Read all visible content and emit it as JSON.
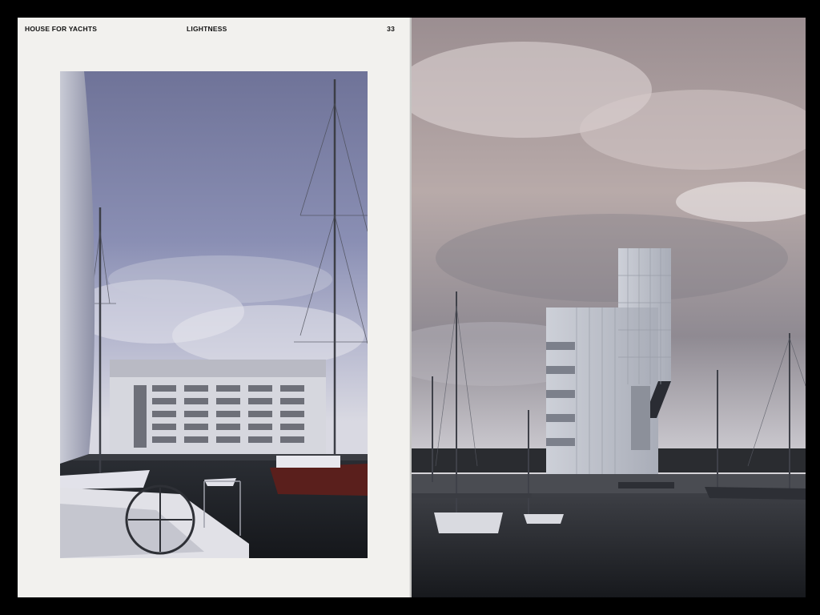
{
  "header": {
    "title_left": "HOUSE FOR YACHTS",
    "title_center": "LIGHTNESS",
    "page_number": "33"
  },
  "colors": {
    "page_paper": "#f2f1ee",
    "background": "#000000",
    "sky_left": "#7f86ad",
    "sky_right": "#a79998",
    "water": "#1f2327"
  },
  "images": {
    "left_photo": "marina-render-with-sailboats-and-long-building",
    "right_photo": "marina-render-with-white-tower-at-dusk"
  }
}
